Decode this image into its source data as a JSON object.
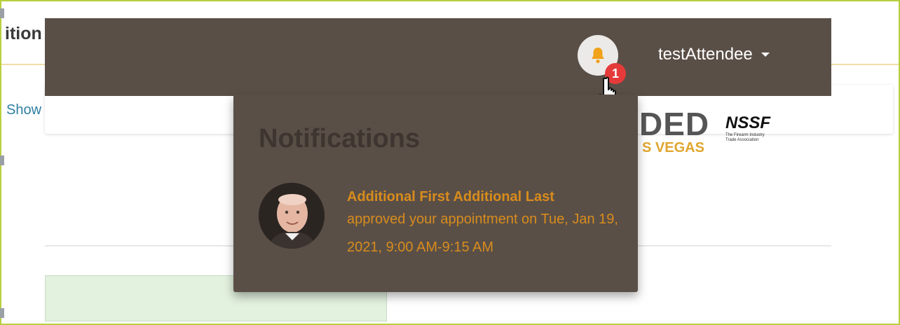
{
  "background": {
    "title_fragment": "ition",
    "show_fragment": "Show",
    "logo": {
      "big_text": "DED",
      "city_text": "S VEGAS",
      "partner_text": "NSSF",
      "partner_sub": "The Firearm Industry Trade Association"
    }
  },
  "navbar": {
    "user_name": "testAttendee",
    "notification_count": "1",
    "bell_icon": "bell-icon"
  },
  "notifications": {
    "title": "Notifications",
    "header_link": "",
    "items": [
      {
        "name": "Additional First Additional Last",
        "message": "approved your appointment on Tue, Jan 19, 2021, 9:00 AM-9:15 AM"
      }
    ]
  },
  "colors": {
    "navbar": "#5a4f47",
    "notif_text": "#d88c1c",
    "badge": "#e53a3a",
    "frame": "#b9cf3c"
  }
}
